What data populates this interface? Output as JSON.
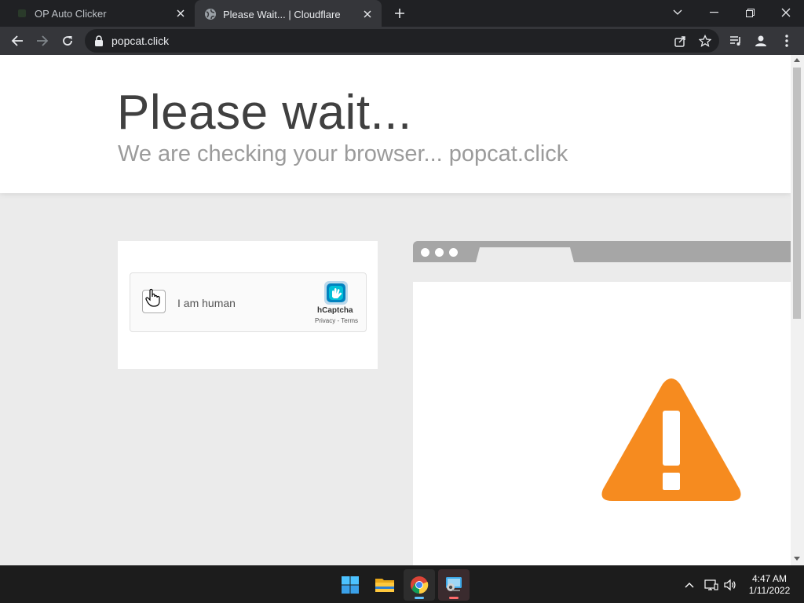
{
  "browser": {
    "tabs": [
      {
        "title": "OP Auto Clicker",
        "active": false,
        "favicon": "auto-clicker-icon"
      },
      {
        "title": "Please Wait... | Cloudflare",
        "active": true,
        "favicon": "globe-icon"
      }
    ],
    "url": "popcat.click",
    "colors": {
      "frame": "#202124",
      "toolbar": "#35363a"
    }
  },
  "page": {
    "title": "Please wait...",
    "subtitle": "We are checking your browser... popcat.click"
  },
  "captcha": {
    "label": "I am human",
    "brand": "hCaptcha",
    "privacy": "Privacy",
    "separator": " - ",
    "terms": "Terms",
    "checked": false
  },
  "illustration": {
    "warning_color": "#f68b1f"
  },
  "taskbar": {
    "apps": [
      "windows-start-icon",
      "file-explorer-icon",
      "chrome-icon",
      "remote-desktop-icon"
    ],
    "time": "4:47 AM",
    "date": "1/11/2022"
  }
}
